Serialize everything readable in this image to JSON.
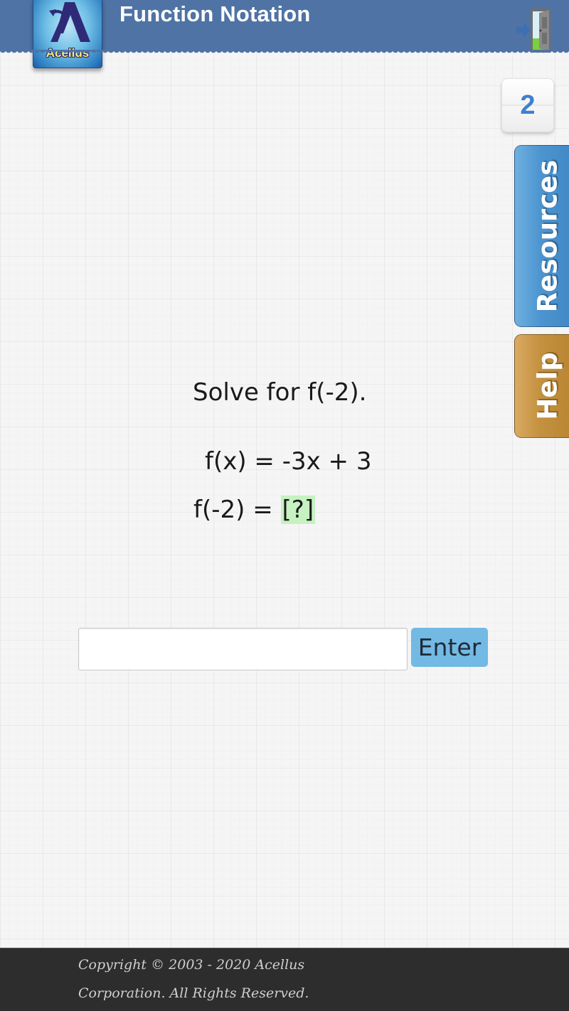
{
  "header": {
    "title": "Function Notation",
    "logo_text": "Acellus",
    "exit_icon": "exit-door-icon",
    "background_color": "#4f73a4"
  },
  "page_counter": {
    "value": "2"
  },
  "side_tabs": [
    {
      "label": "Resources",
      "color": "#4d95d0"
    },
    {
      "label": "Help",
      "color": "#c4913f"
    }
  ],
  "question": {
    "prompt": "Solve for f(-2).",
    "equation": "f(x) = -3x + 3",
    "answer_prefix": "f(-2) = ",
    "blank": "[?]",
    "blank_color": "#c6f2c1"
  },
  "answer_form": {
    "input_value": "",
    "input_placeholder": "",
    "enter_label": "Enter",
    "enter_color": "#72b9e3"
  },
  "footer": {
    "line1": "Copyright © 2003 - 2020 Acellus",
    "line2": "Corporation.  All Rights Reserved."
  }
}
